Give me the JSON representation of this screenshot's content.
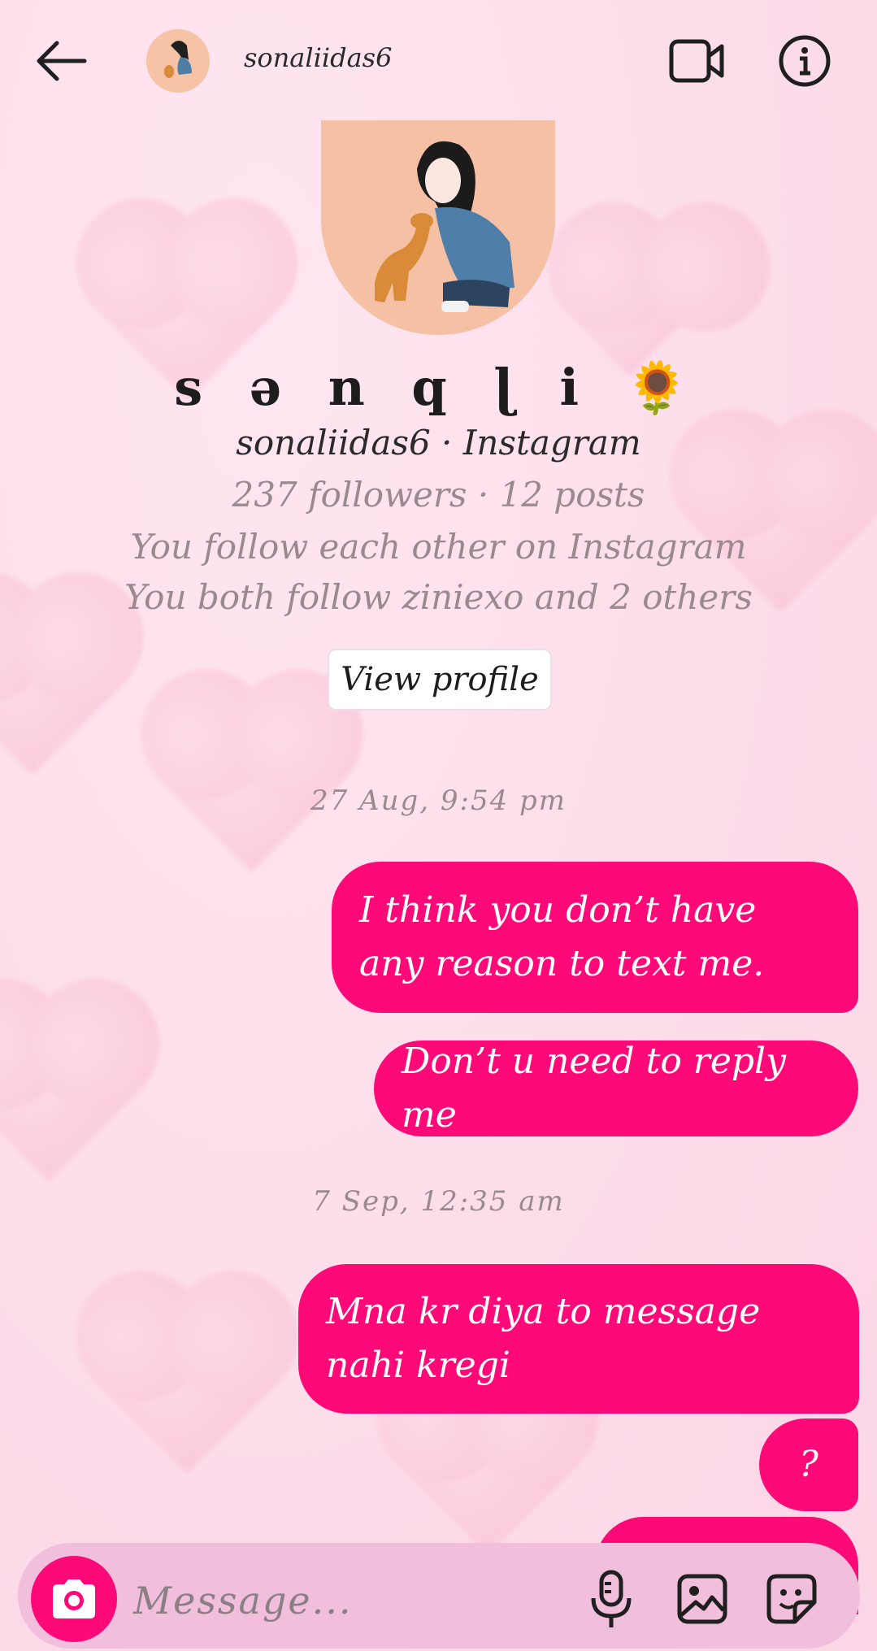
{
  "header": {
    "username": "sonaliidas6",
    "back_icon": "arrow-left-icon",
    "video_icon": "video-call-icon",
    "info_icon": "info-icon"
  },
  "profile": {
    "display_name": "s ə n q ɭ i 🌻",
    "handle_line": "sonaliidas6 · Instagram",
    "stats_line": "237 followers · 12 posts",
    "mutual_line": "You follow each other on Instagram",
    "common_line": "You both follow ziniexo and 2 others",
    "view_profile_label": "View profile"
  },
  "messages": {
    "timestamp_1": "27 Aug, 9:54 pm",
    "msg_1": "I think you don’t have any reason to text me.",
    "msg_2": "Don’t u need to reply me",
    "timestamp_2": "7 Sep, 12:35 am",
    "msg_3": "Mna kr diya to message nahi kregi",
    "msg_4": "?"
  },
  "composer": {
    "placeholder": "Message...",
    "camera_icon": "camera-icon",
    "mic_icon": "microphone-icon",
    "gallery_icon": "gallery-icon",
    "sticker_icon": "sticker-icon"
  },
  "colors": {
    "accent": "#fe0a78",
    "background": "#fde0ec",
    "composer": "#f1bedb"
  }
}
